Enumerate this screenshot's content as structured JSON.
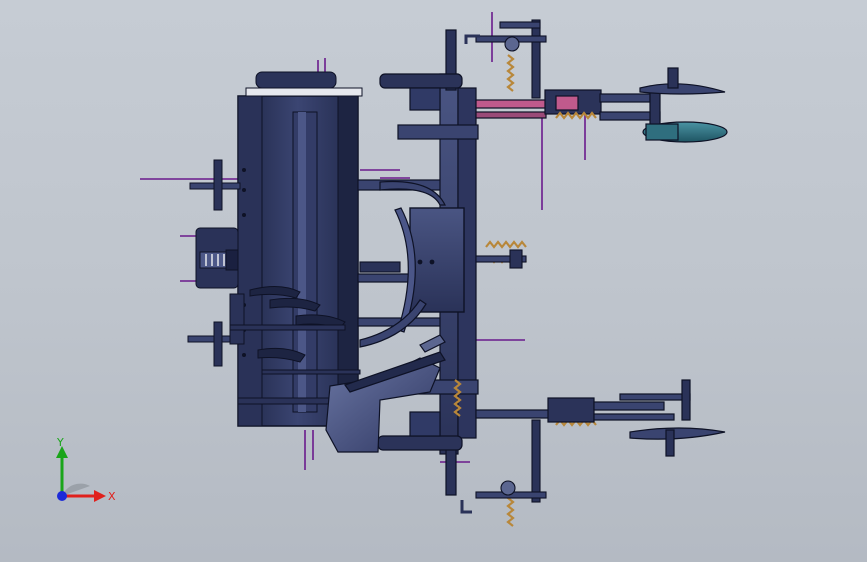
{
  "viewport": {
    "background_top": "#c6ccd4",
    "background_bottom": "#b4bac3"
  },
  "model": {
    "colors": {
      "body_dark": "#222a4c",
      "body_mid": "#3a4470",
      "body_light": "#5b6690",
      "edge": "#0e1226",
      "disc_teal": "#2f6e7e",
      "rod_pink": "#c05a8c",
      "spring_orange": "#b8873a",
      "annotation_purple": "#6a1a8c"
    }
  },
  "triad": {
    "x_label": "X",
    "y_label": "Y",
    "x_color": "#e0201c",
    "y_color": "#1aa51a",
    "z_color": "#1c2ad8"
  }
}
